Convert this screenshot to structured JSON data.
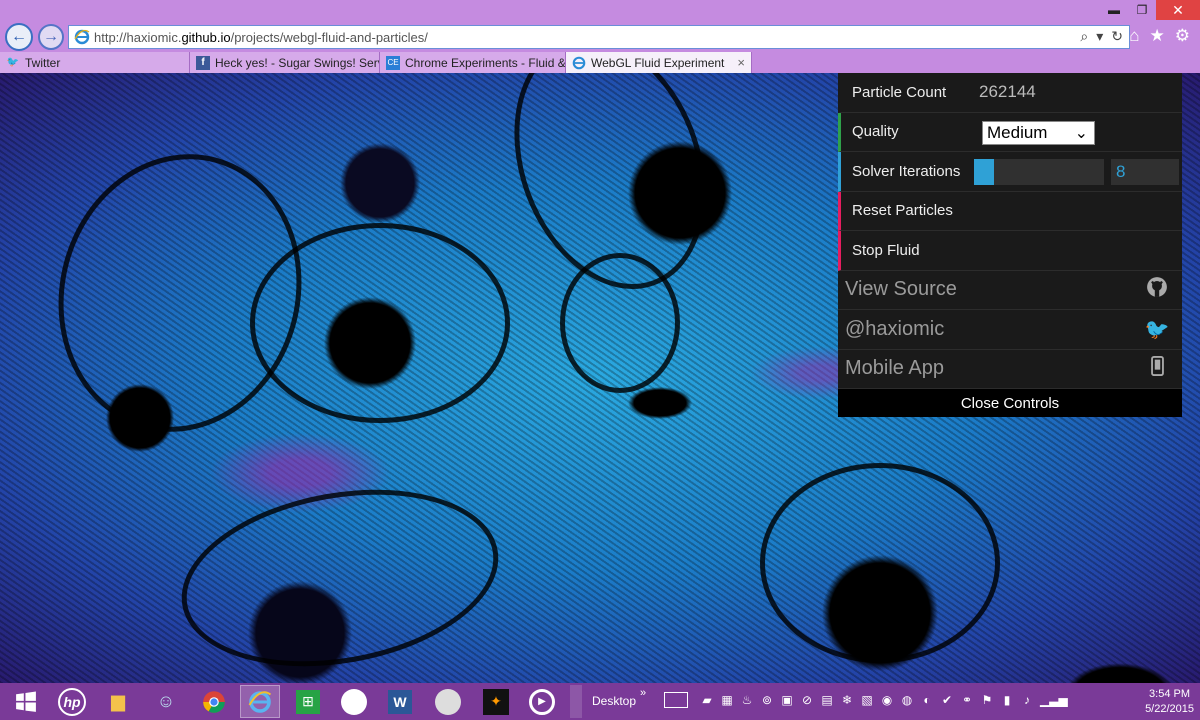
{
  "browser": {
    "url_prefix": "http://haxiomic.",
    "url_host": "github.io",
    "url_path": "/projects/webgl-fluid-and-particles/",
    "window_buttons": {
      "minimize": "▬",
      "restore": "❐",
      "close": "✕"
    },
    "tabs": [
      {
        "label": "Twitter",
        "icon": "twitter-icon",
        "color": "#1da1f2",
        "active": false
      },
      {
        "label": "Heck yes! - Sugar Swings! Serv...",
        "icon": "facebook-icon",
        "color": "#3b5998",
        "active": false
      },
      {
        "label": "Chrome Experiments - Fluid & ...",
        "icon": "ce-icon",
        "color": "#2a7ed6",
        "active": false
      },
      {
        "label": "WebGL Fluid Experiment",
        "icon": "ie-icon",
        "color": "#2a8bd6",
        "active": true
      }
    ],
    "tab_close": "×"
  },
  "controls": {
    "particle_count_label": "Particle Count",
    "particle_count_value": "262144",
    "quality_label": "Quality",
    "quality_value": "Medium",
    "solver_label": "Solver Iterations",
    "solver_value": "8",
    "solver_fraction": 0.15,
    "reset_label": "Reset Particles",
    "stop_label": "Stop Fluid",
    "view_source_label": "View Source",
    "twitter_label": "@haxiomic",
    "mobile_label": "Mobile App",
    "close_label": "Close Controls",
    "accent_colors": {
      "green": "#2fa14a",
      "blue": "#2fa1d6",
      "red": "#e61d5f"
    }
  },
  "taskbar": {
    "desktop_label": "Desktop",
    "chevron": "»",
    "time": "3:54 PM",
    "date": "5/22/2015"
  }
}
